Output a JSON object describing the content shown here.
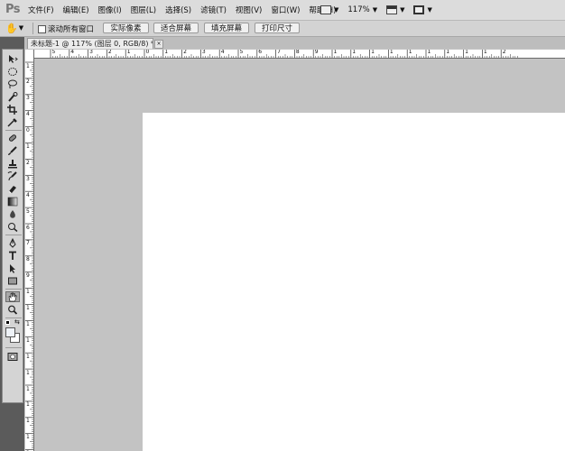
{
  "app": {
    "logo": "Ps"
  },
  "menu": {
    "items": [
      "文件(F)",
      "编辑(E)",
      "图像(I)",
      "图层(L)",
      "选择(S)",
      "滤镜(T)",
      "视图(V)",
      "窗口(W)",
      "帮助(H)"
    ],
    "zoom": "117%",
    "controls": [
      "launch-bridge-icon",
      "arrange-documents-icon",
      "screen-mode-icon"
    ]
  },
  "options": {
    "tool_icon": "hand-icon",
    "scroll_all": {
      "label": "滚动所有窗口",
      "checked": false
    },
    "buttons": [
      "实际像素",
      "适合屏幕",
      "填充屏幕",
      "打印尺寸"
    ]
  },
  "document": {
    "tab_title": "未标题-1 @ 117% (图层 0, RGB/8) *",
    "close_symbol": "×"
  },
  "tools": [
    "move-tool-icon",
    "marquee-tool-icon",
    "lasso-tool-icon",
    "quick-select-tool-icon",
    "crop-tool-icon",
    "eyedropper-tool-icon",
    "spot-healing-tool-icon",
    "brush-tool-icon",
    "clone-stamp-tool-icon",
    "history-brush-tool-icon",
    "eraser-tool-icon",
    "gradient-tool-icon",
    "blur-tool-icon",
    "dodge-tool-icon",
    "pen-tool-icon",
    "type-tool-icon",
    "path-select-tool-icon",
    "rectangle-tool-icon",
    "hand-tool-icon",
    "zoom-tool-icon"
  ],
  "colors": {
    "foreground": "#000000",
    "background": "#ffffff",
    "ui_bg": "#c3c3c3",
    "toolbar_dark": "#5b5b5b"
  },
  "rulers": {
    "top_labels": [
      "5",
      "4",
      "3",
      "2",
      "1",
      "0",
      "1",
      "2",
      "3",
      "4",
      "5",
      "6",
      "7",
      "8",
      "9",
      "1",
      "1",
      "1",
      "1",
      "1",
      "1",
      "1",
      "1",
      "1",
      "2"
    ],
    "left_labels": [
      "1",
      "2",
      "3",
      "4",
      "0",
      "1",
      "2",
      "3",
      "4",
      "5",
      "6",
      "7",
      "8",
      "9",
      "1",
      "1",
      "1",
      "1",
      "1",
      "1",
      "1",
      "1",
      "1",
      "1",
      "2"
    ]
  }
}
